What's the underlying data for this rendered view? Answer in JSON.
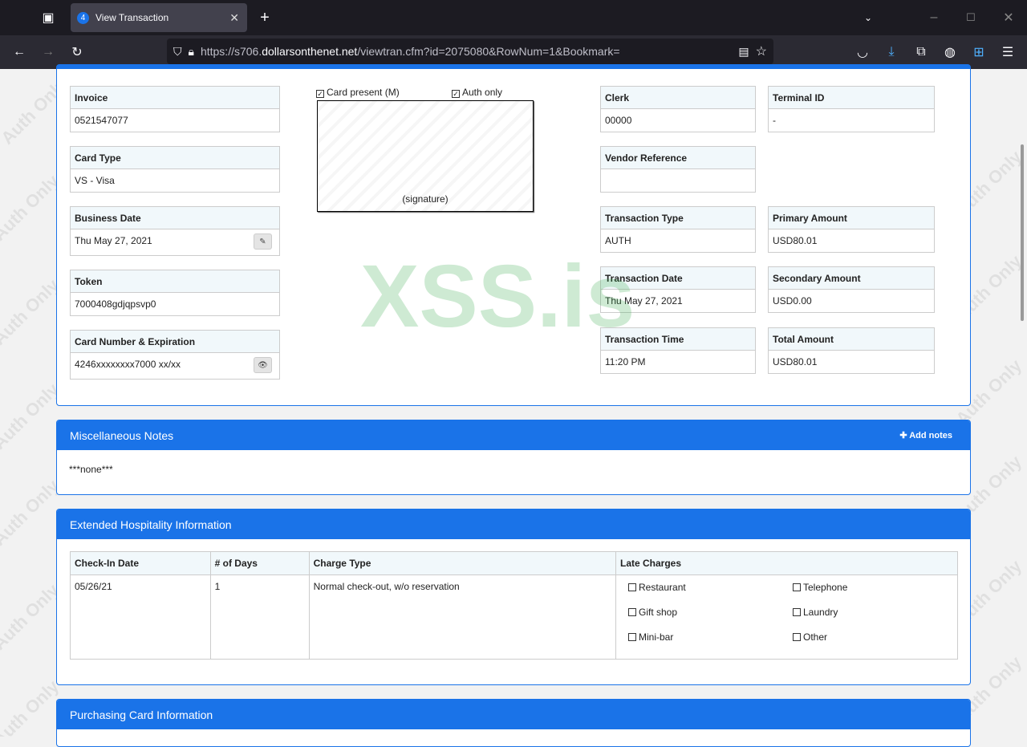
{
  "browser": {
    "tab_title": "View Transaction",
    "tab_badge": "4",
    "url_prefix": "https://s706.",
    "url_domain": "dollarsonthenet.net",
    "url_path": "/viewtran.cfm?id=2075080&RowNum=1&Bookmark="
  },
  "watermarks": {
    "background": "Auth Only",
    "center": "XSS.is"
  },
  "transaction": {
    "invoice": {
      "label": "Invoice",
      "value": "0521547077"
    },
    "card_type": {
      "label": "Card Type",
      "value": "VS - Visa"
    },
    "business_date": {
      "label": "Business Date",
      "value": "Thu May 27, 2021"
    },
    "token": {
      "label": "Token",
      "value": "7000408gdjqpsvp0"
    },
    "card_number": {
      "label": "Card Number & Expiration",
      "value": "4246xxxxxxxx7000 xx/xx"
    },
    "card_present": "Card present (M)",
    "auth_only": "Auth only",
    "signature": "(signature)",
    "clerk": {
      "label": "Clerk",
      "value": "00000"
    },
    "terminal": {
      "label": "Terminal ID",
      "value": "-"
    },
    "vendor_ref": {
      "label": "Vendor Reference",
      "value": ""
    },
    "trans_type": {
      "label": "Transaction Type",
      "value": "AUTH"
    },
    "primary_amount": {
      "label": "Primary Amount",
      "value": "USD80.01"
    },
    "trans_date": {
      "label": "Transaction Date",
      "value": "Thu May 27, 2021"
    },
    "secondary_amount": {
      "label": "Secondary Amount",
      "value": "USD0.00"
    },
    "trans_time": {
      "label": "Transaction Time",
      "value": "11:20 PM"
    },
    "total_amount": {
      "label": "Total Amount",
      "value": "USD80.01"
    }
  },
  "notes": {
    "title": "Miscellaneous Notes",
    "add_label": "Add notes",
    "content": "***none***"
  },
  "hospitality": {
    "title": "Extended Hospitality Information",
    "headers": [
      "Check-In Date",
      "# of Days",
      "Charge Type",
      "Late Charges"
    ],
    "row": [
      "05/26/21",
      "1",
      "Normal check-out, w/o reservation"
    ],
    "late_charges": [
      "Restaurant",
      "Telephone",
      "Gift shop",
      "Laundry",
      "Mini-bar",
      "Other"
    ]
  },
  "purchasing": {
    "title": "Purchasing Card Information"
  }
}
